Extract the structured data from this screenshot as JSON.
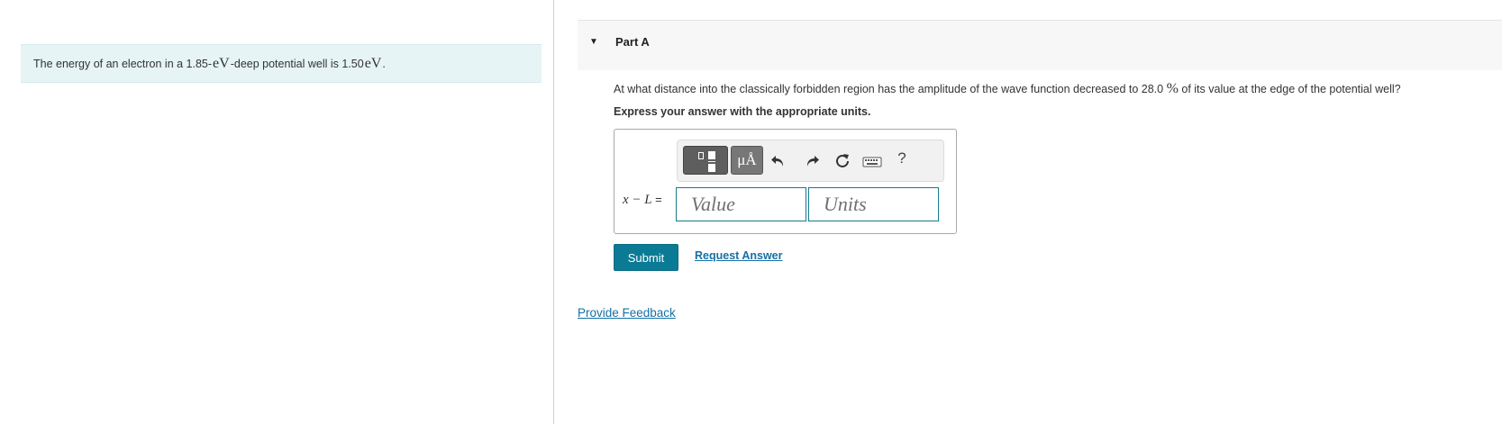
{
  "intro": {
    "text_before": "The energy of an electron in a 1.85-",
    "unit_ev_1": "eV",
    "text_middle": "-deep potential well is 1.50 ",
    "unit_ev_2": "eV",
    "text_after": "."
  },
  "part": {
    "title": "Part A",
    "question_before": "At what distance into the classically forbidden region has the amplitude of the wave function decreased to 28.0 ",
    "question_percent": "%",
    "question_after": " of its value at the edge of the potential well?",
    "instruction": "Express your answer with the appropriate units."
  },
  "answer": {
    "variable_label": "x − L",
    "equals": "=",
    "value_placeholder": "Value",
    "units_placeholder": "Units"
  },
  "toolbar": {
    "units_button_label": "μÅ",
    "help_label": "?",
    "icons": [
      "templates-icon",
      "undo-icon",
      "redo-icon",
      "reset-icon",
      "keyboard-icon",
      "help-icon"
    ]
  },
  "actions": {
    "submit_label": "Submit",
    "request_answer_label": "Request Answer",
    "feedback_label": "Provide Feedback"
  },
  "colors": {
    "intro_background": "#e6f4f5",
    "primary_button": "#0b7a95",
    "link": "#1570a6",
    "input_border": "#16798f"
  }
}
